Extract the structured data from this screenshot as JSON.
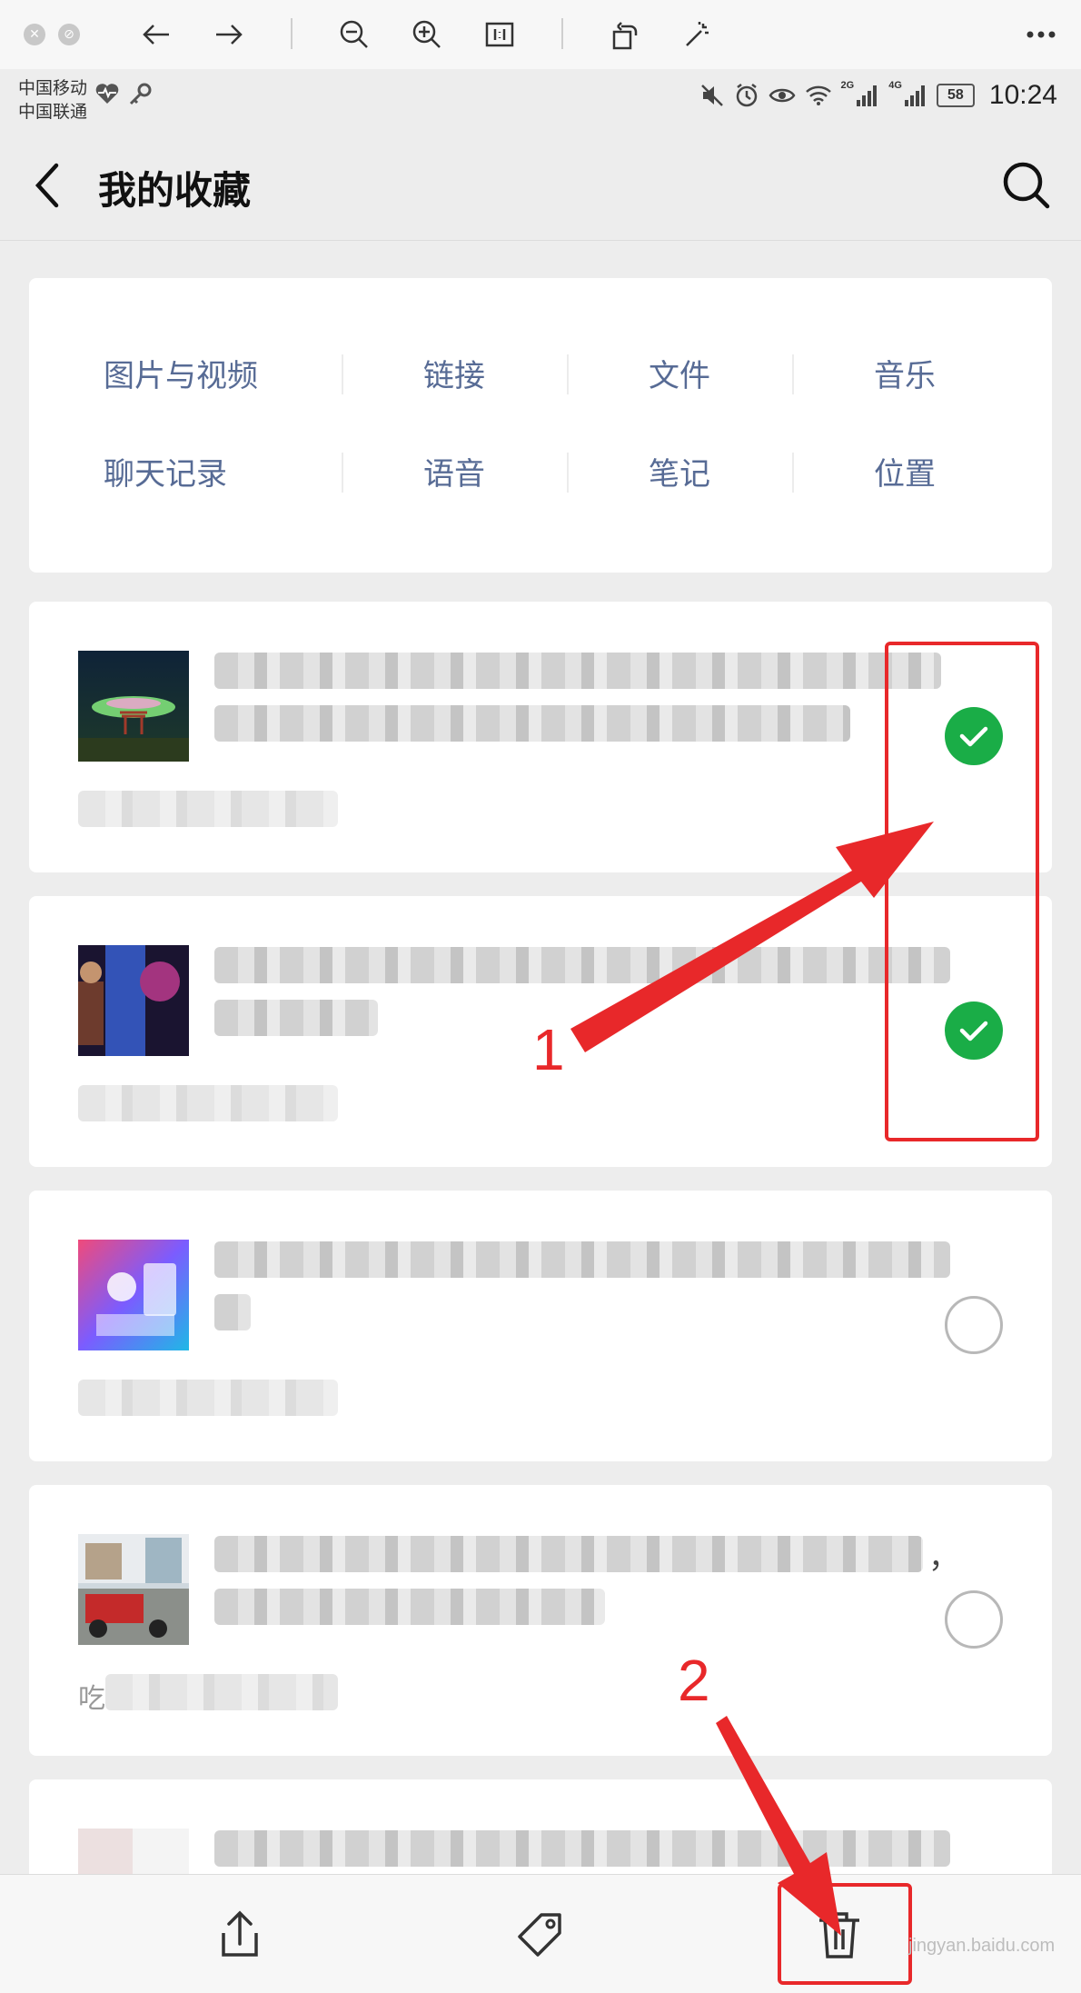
{
  "status_bar": {
    "carrier_1": "中国移动",
    "carrier_2": "中国联通",
    "network_1": "2G",
    "network_2": "4G",
    "battery": "58",
    "time": "10:24"
  },
  "header": {
    "title": "我的收藏"
  },
  "categories": {
    "row1": [
      "图片与视频",
      "链接",
      "文件",
      "音乐"
    ],
    "row2": [
      "聊天记录",
      "语音",
      "笔记",
      "位置"
    ]
  },
  "items": [
    {
      "selected": true,
      "thumbnail": "night-sky-torii-image"
    },
    {
      "selected": true,
      "thumbnail": "game-character-image"
    },
    {
      "selected": false,
      "thumbnail": "tech-illustration-image"
    },
    {
      "selected": false,
      "thumbnail": "street-scene-image",
      "visible_prefix": "吃",
      "trailing_char": "，"
    }
  ],
  "toolbar": {
    "icons": [
      "share-icon",
      "tag-icon",
      "trash-icon"
    ]
  },
  "annotations": {
    "step1": "1",
    "step2": "2",
    "color": "#e8282a"
  },
  "watermark": "jingyan.baidu.com",
  "colors": {
    "link_blue": "#576b95",
    "check_green": "#1aad47",
    "background": "#ededed"
  }
}
